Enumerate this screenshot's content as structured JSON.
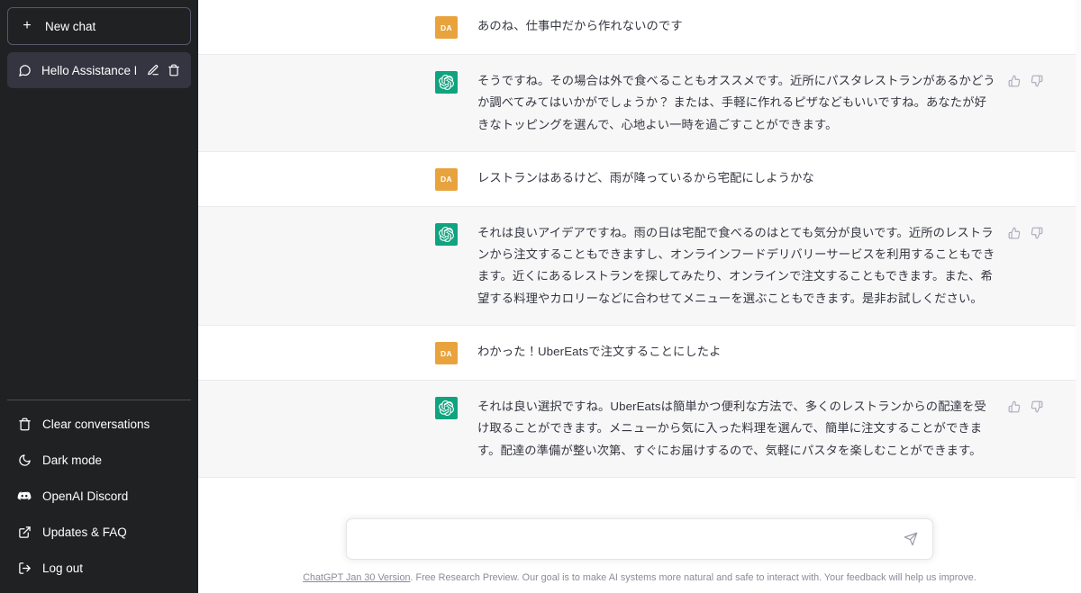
{
  "sidebar": {
    "new_chat": {
      "label": "New chat",
      "icon": "plus-icon"
    },
    "chats": [
      {
        "label": "Hello Assistance Reque",
        "icon": "chat-bubble-icon",
        "active": true,
        "edit_icon": "pencil-icon",
        "delete_icon": "trash-icon"
      }
    ],
    "footer_items": [
      {
        "label": "Clear conversations",
        "icon": "trash-icon"
      },
      {
        "label": "Dark mode",
        "icon": "moon-icon"
      },
      {
        "label": "OpenAI Discord",
        "icon": "discord-icon"
      },
      {
        "label": "Updates & FAQ",
        "icon": "external-link-icon"
      },
      {
        "label": "Log out",
        "icon": "logout-icon"
      }
    ]
  },
  "colors": {
    "sidebar_bg": "#202123",
    "sidebar_active": "#343541",
    "user_avatar": "#e8a33d",
    "assistant_avatar": "#10a37f",
    "assistant_row_bg": "#f7f7f8",
    "user_row_bg": "#ffffff",
    "text": "#353740"
  },
  "thread": {
    "messages": [
      {
        "role": "user",
        "avatar_initials": "DA",
        "text": "あのね、仕事中だから作れないのです"
      },
      {
        "role": "assistant",
        "avatar_icon": "openai-logo-icon",
        "text": "そうですね。その場合は外で食べることもオススメです。近所にパスタレストランがあるかどうか調べてみてはいかがでしょうか？ または、手軽に作れるピザなどもいいですね。あなたが好きなトッピングを選んで、心地よい一時を過ごすことができます。",
        "thumbs_up_icon": "thumbs-up-icon",
        "thumbs_down_icon": "thumbs-down-icon"
      },
      {
        "role": "user",
        "avatar_initials": "DA",
        "text": "レストランはあるけど、雨が降っているから宅配にしようかな"
      },
      {
        "role": "assistant",
        "avatar_icon": "openai-logo-icon",
        "text": "それは良いアイデアですね。雨の日は宅配で食べるのはとても気分が良いです。近所のレストランから注文することもできますし、オンラインフードデリバリーサービスを利用することもできます。近くにあるレストランを探してみたり、オンラインで注文することもできます。また、希望する料理やカロリーなどに合わせてメニューを選ぶこともできます。是非お試しください。",
        "thumbs_up_icon": "thumbs-up-icon",
        "thumbs_down_icon": "thumbs-down-icon"
      },
      {
        "role": "user",
        "avatar_initials": "DA",
        "text": "わかった！UberEatsで注文することにしたよ"
      },
      {
        "role": "assistant",
        "avatar_icon": "openai-logo-icon",
        "text": "それは良い選択ですね。UberEatsは簡単かつ便利な方法で、多くのレストランからの配達を受け取ることができます。メニューから気に入った料理を選んで、簡単に注文することができます。配達の準備が整い次第、すぐにお届けするので、気軽にパスタを楽しむことができます。",
        "thumbs_up_icon": "thumbs-up-icon",
        "thumbs_down_icon": "thumbs-down-icon"
      }
    ]
  },
  "composer": {
    "value": "",
    "placeholder": "",
    "send_icon": "send-paper-plane-icon"
  },
  "disclaimer": {
    "link_text": "ChatGPT Jan 30 Version",
    "rest_text": ". Free Research Preview. Our goal is to make AI systems more natural and safe to interact with. Your feedback will help us improve."
  }
}
